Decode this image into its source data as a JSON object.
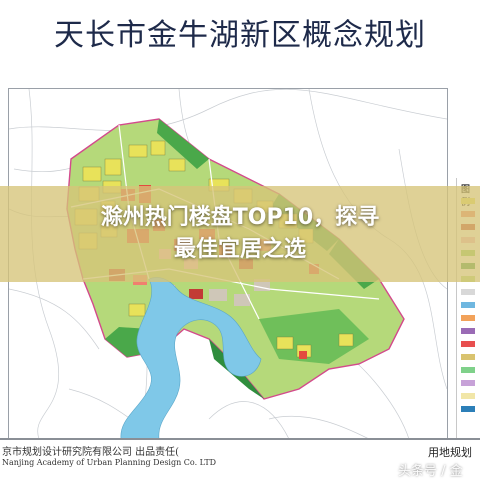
{
  "map": {
    "title": "天长市金牛湖新区概念规划"
  },
  "banner": {
    "line1": "滁州热门楼盘TOP10，探寻",
    "line2": "最佳宜居之选"
  },
  "legend": {
    "title": "图 例",
    "swatches": [
      "#e8e25a",
      "#f07f6f",
      "#c23b35",
      "#f4b8c8",
      "#8fcf5a",
      "#3d9b45",
      "#b8e07a",
      "#d8d8d8",
      "#6fb7e0",
      "#f2a25a",
      "#9a6bb5",
      "#e84f4f",
      "#d9c36f",
      "#7fd18a",
      "#c7a2d8",
      "#f1e6a8",
      "#2c7fb8"
    ]
  },
  "footer": {
    "institute_cn": "京市规划设计研究院有限公司 出品责任(",
    "institute_en": "Nanjing Academy of Urban Planning Design Co. LTD",
    "sheet": "用地规划"
  },
  "watermark": {
    "text": "头条号 / 金"
  },
  "colors": {
    "water": "#7fc8e8",
    "residential": "#e8e25a",
    "commercial": "#e34b3f",
    "green": "#4aa84a",
    "light_green": "#a7d86a",
    "banner": "#d6c478"
  }
}
